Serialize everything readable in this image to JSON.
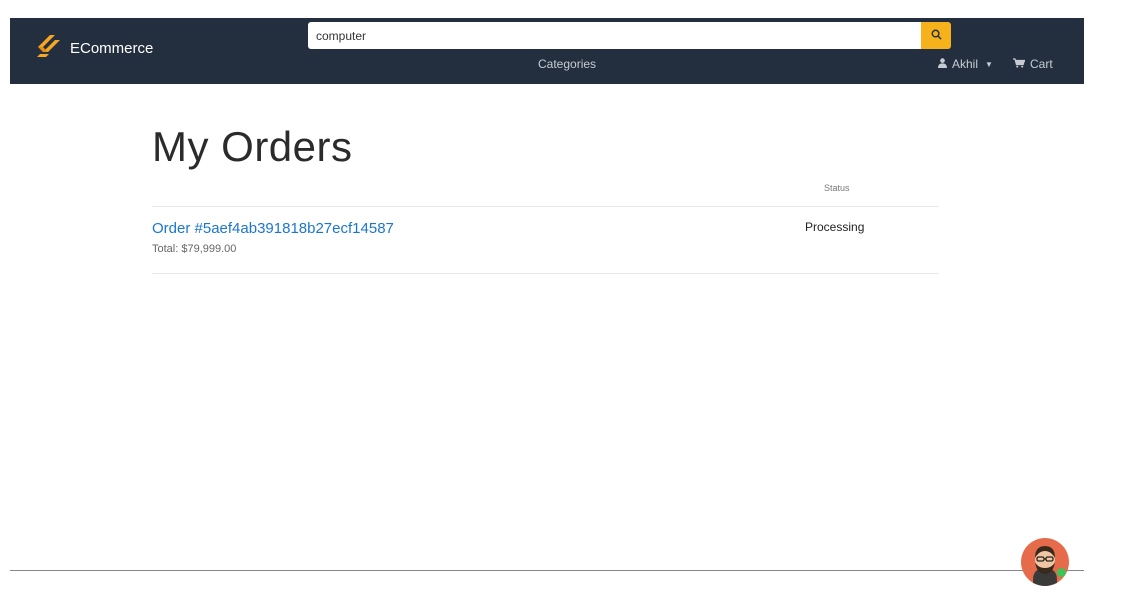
{
  "header": {
    "brand": "ECommerce",
    "search": {
      "value": "computer"
    },
    "categories": "Categories",
    "user": "Akhil",
    "cart": "Cart"
  },
  "icons": {
    "logo": "ecommerce-logo-icon",
    "search": "search-icon",
    "user": "user-icon",
    "caret": "caret-down-icon",
    "cart": "cart-icon",
    "chat": "chat-avatar-icon"
  },
  "colors": {
    "navbar": "#232f3e",
    "search_button": "#f6b21a",
    "link": "#1b76d2",
    "logo": "#f6a623",
    "chat_bubble": "#e66b4a",
    "online_dot": "#3cc45a"
  },
  "main": {
    "title": "My Orders",
    "status_header": "Status",
    "orders": [
      {
        "id": "Order #5aef4ab391818b27ecf14587",
        "total": "Total: $79,999.00",
        "status": "Processing"
      }
    ]
  }
}
